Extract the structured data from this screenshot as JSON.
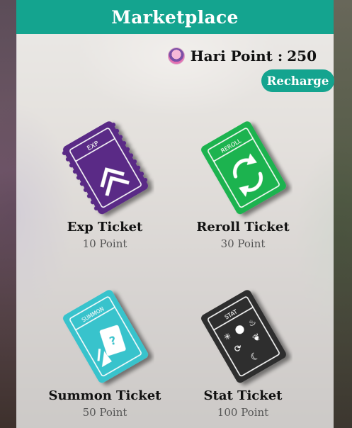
{
  "header": {
    "title": "Marketplace"
  },
  "account": {
    "points_label": "Hari Point :",
    "points_value": "250",
    "recharge_label": "Recharge"
  },
  "items": [
    {
      "title": "Exp Ticket",
      "price": "10 Point",
      "ticket_label": "EXP",
      "color": "#5a2a86",
      "icon": "double-chevron-up-icon"
    },
    {
      "title": "Reroll Ticket",
      "price": "30 Point",
      "ticket_label": "REROLL",
      "color": "#1db34f",
      "icon": "refresh-icon"
    },
    {
      "title": "Summon Ticket",
      "price": "50 Point",
      "ticket_label": "SUMMON",
      "color": "#37c3cc",
      "icon": "summon-card-icon"
    },
    {
      "title": "Stat Ticket",
      "price": "100 Point",
      "ticket_label": "STAT",
      "color": "#2e2e2e",
      "icon": "stat-symbols-icon"
    }
  ]
}
